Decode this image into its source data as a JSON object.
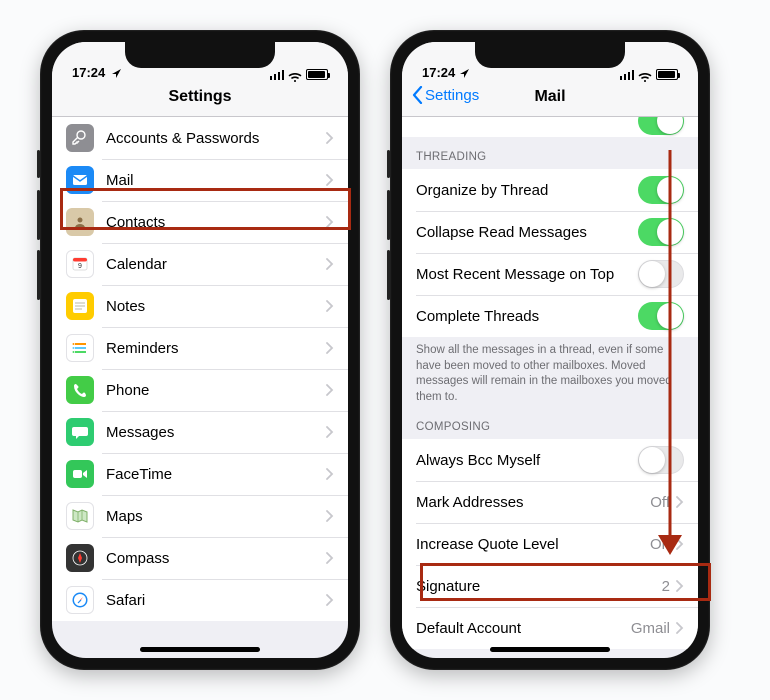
{
  "statusbar": {
    "time": "17:24"
  },
  "highlight_color": "#a82a12",
  "phone1": {
    "title": "Settings",
    "rows": [
      {
        "id": "accounts-passwords",
        "label": "Accounts & Passwords",
        "icon": "key-icon",
        "icon_bg": "bg-grey"
      },
      {
        "id": "mail",
        "label": "Mail",
        "icon": "mail-icon",
        "icon_bg": "bg-blue",
        "highlighted": true
      },
      {
        "id": "contacts",
        "label": "Contacts",
        "icon": "contacts-icon",
        "icon_bg": "bg-tan"
      },
      {
        "id": "calendar",
        "label": "Calendar",
        "icon": "calendar-icon",
        "icon_bg": "bg-white"
      },
      {
        "id": "notes",
        "label": "Notes",
        "icon": "notes-icon",
        "icon_bg": "bg-yellow"
      },
      {
        "id": "reminders",
        "label": "Reminders",
        "icon": "reminders-icon",
        "icon_bg": "bg-white"
      },
      {
        "id": "phone",
        "label": "Phone",
        "icon": "phone-icon",
        "icon_bg": "bg-green"
      },
      {
        "id": "messages",
        "label": "Messages",
        "icon": "messages-icon",
        "icon_bg": "bg-green2"
      },
      {
        "id": "facetime",
        "label": "FaceTime",
        "icon": "facetime-icon",
        "icon_bg": "bg-gr3"
      },
      {
        "id": "maps",
        "label": "Maps",
        "icon": "maps-icon",
        "icon_bg": "bg-white"
      },
      {
        "id": "compass",
        "label": "Compass",
        "icon": "compass-icon",
        "icon_bg": "bg-dark"
      },
      {
        "id": "safari",
        "label": "Safari",
        "icon": "safari-icon",
        "icon_bg": "bg-white"
      }
    ]
  },
  "phone2": {
    "back": "Settings",
    "title": "Mail",
    "threading_header": "THREADING",
    "threading_rows": [
      {
        "id": "organize-thread",
        "label": "Organize by Thread",
        "toggle": "on"
      },
      {
        "id": "collapse-read",
        "label": "Collapse Read Messages",
        "toggle": "on"
      },
      {
        "id": "most-recent-top",
        "label": "Most Recent Message on Top",
        "toggle": "off"
      },
      {
        "id": "complete-threads",
        "label": "Complete Threads",
        "toggle": "on"
      }
    ],
    "threading_footer": "Show all the messages in a thread, even if some have been moved to other mailboxes. Moved messages will remain in the mailboxes you moved them to.",
    "composing_header": "COMPOSING",
    "composing_rows": [
      {
        "id": "always-bcc",
        "label": "Always Bcc Myself",
        "toggle": "off"
      },
      {
        "id": "mark-addresses",
        "label": "Mark Addresses",
        "detail": "Off",
        "chevron": true
      },
      {
        "id": "increase-quote",
        "label": "Increase Quote Level",
        "detail": "On",
        "chevron": true
      },
      {
        "id": "signature",
        "label": "Signature",
        "detail": "2",
        "chevron": true,
        "highlighted": true
      },
      {
        "id": "default-account",
        "label": "Default Account",
        "detail": "Gmail",
        "chevron": true
      }
    ]
  }
}
